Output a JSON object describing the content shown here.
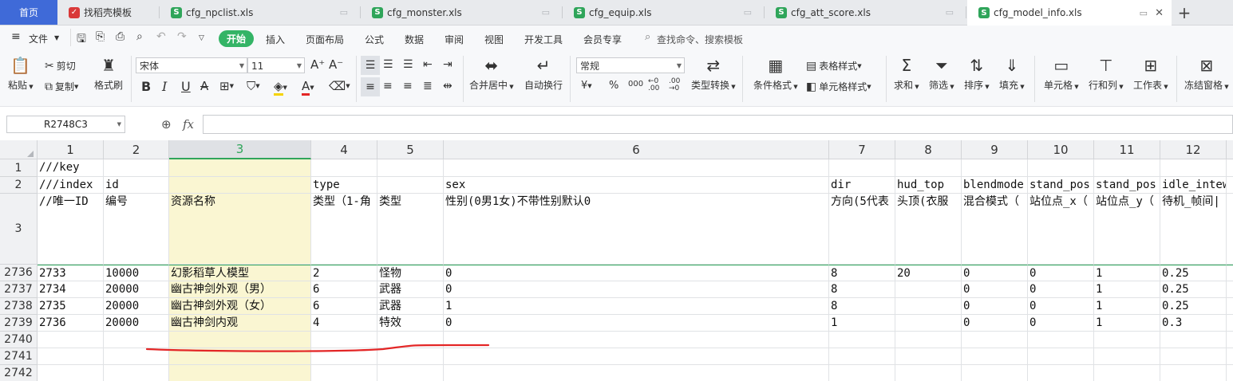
{
  "tabs": {
    "home": "首页",
    "items": [
      {
        "label": "找稻壳模板",
        "icon": "docer-icon",
        "color": "#d93838"
      },
      {
        "label": "cfg_npclist.xls",
        "icon": "spreadsheet-icon",
        "color": "#2fa55a"
      },
      {
        "label": "cfg_monster.xls",
        "icon": "spreadsheet-icon",
        "color": "#2fa55a"
      },
      {
        "label": "cfg_equip.xls",
        "icon": "spreadsheet-icon",
        "color": "#2fa55a"
      },
      {
        "label": "cfg_att_score.xls",
        "icon": "spreadsheet-icon",
        "color": "#2fa55a"
      },
      {
        "label": "cfg_model_info.xls",
        "icon": "spreadsheet-icon",
        "color": "#2fa55a"
      }
    ],
    "add": "+"
  },
  "menu": {
    "file": "文件",
    "items": [
      "开始",
      "插入",
      "页面布局",
      "公式",
      "数据",
      "审阅",
      "视图",
      "开发工具",
      "会员专享"
    ],
    "search": "查找命令、搜索模板"
  },
  "ribbon": {
    "paste": "粘贴",
    "cut": "剪切",
    "copy": "复制",
    "format_painter": "格式刷",
    "font_name": "宋体",
    "font_size": "11",
    "merge_center": "合并居中",
    "wrap_text": "自动换行",
    "number_format": "常规",
    "type_convert": "类型转换",
    "conditional_format": "条件格式",
    "table_style": "表格样式",
    "cell_style": "单元格样式",
    "sum": "求和",
    "filter": "筛选",
    "sort": "排序",
    "fill": "填充",
    "cells": "单元格",
    "row_col": "行和列",
    "worksheet": "工作表",
    "freeze": "冻结窗格"
  },
  "formula_bar": {
    "name_box": "R2748C3",
    "fx": "fx",
    "formula": ""
  },
  "grid": {
    "columns": [
      "1",
      "2",
      "3",
      "4",
      "5",
      "6",
      "7",
      "8",
      "9",
      "10",
      "11",
      "12"
    ],
    "rows": [
      {
        "num": "1",
        "cells": [
          "///key",
          "",
          "",
          "",
          "",
          "",
          "",
          "",
          "",
          "",
          "",
          ""
        ]
      },
      {
        "num": "2",
        "cells": [
          "///index",
          "id",
          "",
          "type",
          "",
          "sex",
          "dir",
          "hud_top",
          "blendmode",
          "stand_pos",
          "stand_pos",
          "idle_intew"
        ]
      },
      {
        "num": "3",
        "cells": [
          "//唯一ID",
          "编号",
          "资源名称",
          "类型（1-角",
          "类型",
          "性别(0男1女)不带性别默认0",
          "方向(5代表",
          "头顶(衣服",
          "混合模式（",
          "站位点_x（",
          "站位点_y（",
          "待机_帧间|"
        ]
      },
      {
        "num": "2736",
        "cells": [
          "2733",
          "10000",
          "幻影稻草人模型",
          "2",
          "怪物",
          "0",
          "8",
          "20",
          "0",
          "0",
          "1",
          "0.25"
        ]
      },
      {
        "num": "2737",
        "cells": [
          "2734",
          "20000",
          "幽古神剑外观（男）",
          "6",
          "武器",
          "0",
          "8",
          "",
          "0",
          "0",
          "1",
          "0.25"
        ]
      },
      {
        "num": "2738",
        "cells": [
          "2735",
          "20000",
          "幽古神剑外观（女）",
          "6",
          "武器",
          "1",
          "8",
          "",
          "0",
          "0",
          "1",
          "0.25"
        ]
      },
      {
        "num": "2739",
        "cells": [
          "2736",
          "20000",
          "幽古神剑内观",
          "4",
          "特效",
          "0",
          "1",
          "",
          "0",
          "0",
          "1",
          "0.3"
        ]
      },
      {
        "num": "2740",
        "cells": [
          "",
          "",
          "",
          "",
          "",
          "",
          "",
          "",
          "",
          "",
          "",
          ""
        ]
      },
      {
        "num": "2741",
        "cells": [
          "",
          "",
          "",
          "",
          "",
          "",
          "",
          "",
          "",
          "",
          "",
          ""
        ]
      },
      {
        "num": "2742",
        "cells": [
          "",
          "",
          "",
          "",
          "",
          "",
          "",
          "",
          "",
          "",
          "",
          ""
        ]
      }
    ],
    "selected_column_color": "#faf6d2",
    "selected_header_color": "#dfe1e5",
    "accent": "#2fa55a",
    "annotation_color": "#e32626"
  }
}
